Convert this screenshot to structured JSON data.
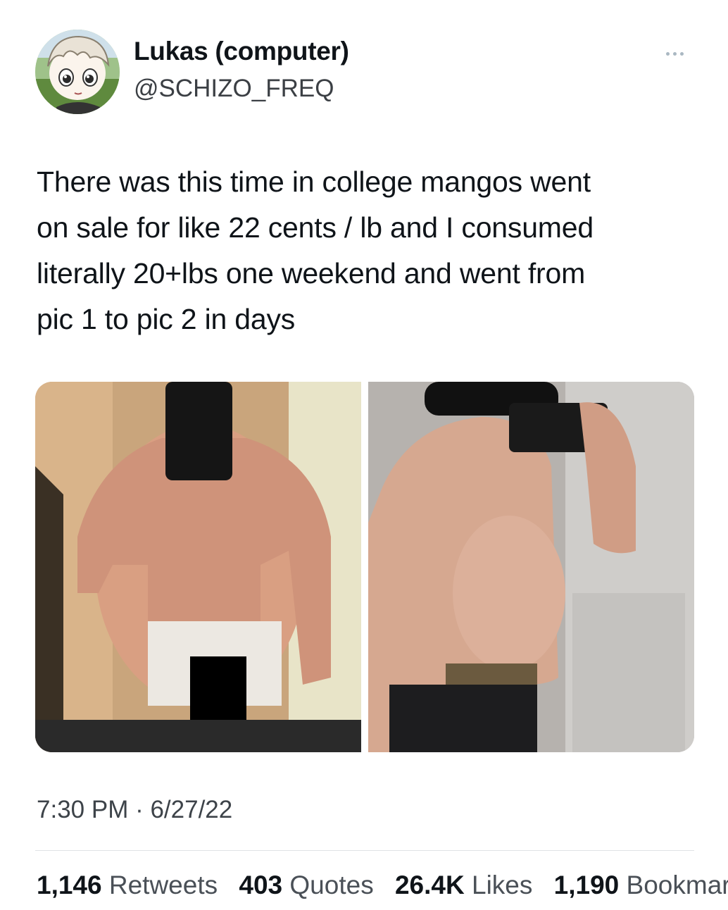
{
  "author": {
    "display_name": "Lukas (computer)",
    "handle": "@SCHIZO_FREQ",
    "avatar_icon": "anime-character-avatar"
  },
  "menu": {
    "icon": "more-options-icon"
  },
  "tweet": {
    "text": "There was this time in college mangos went\non sale for like 22 cents / lb and I consumed\nliterally 20+lbs one weekend and went from\npic 1 to pic 2 in days"
  },
  "meta": {
    "timestamp": "7:30 PM · 6/27/22"
  },
  "stats": [
    {
      "value": "1,146",
      "label": "Retweets"
    },
    {
      "value": "403",
      "label": "Quotes"
    },
    {
      "value": "26.4K",
      "label": "Likes"
    },
    {
      "value": "1,190",
      "label": "Bookmarks"
    }
  ],
  "colors": {
    "text": "#0f1419",
    "secondary": "#3d4349",
    "divider": "#dfe3e6"
  }
}
